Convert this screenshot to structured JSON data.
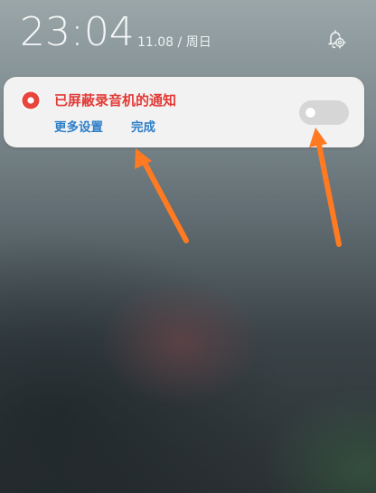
{
  "status_bar": {
    "time": "23:04",
    "date": "11.08 / 周日",
    "settings_icon": "bell-gear-icon"
  },
  "notification": {
    "app_icon": "record-icon",
    "title": "已屏蔽录音机的通知",
    "actions": {
      "more_settings": "更多设置",
      "done": "完成"
    },
    "toggle": {
      "enabled": false
    }
  },
  "annotations": {
    "arrow_color": "#ff7a21",
    "arrow_count": 2
  },
  "colors": {
    "title_red": "#e23a36",
    "action_blue": "#2f7fc8",
    "card_bg": "#f2f2f2",
    "toggle_off": "#d6d6d6"
  }
}
